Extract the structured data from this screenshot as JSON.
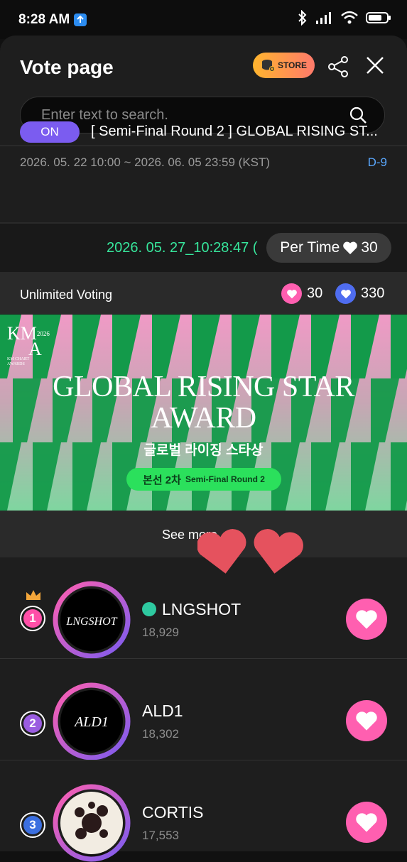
{
  "status_bar": {
    "time": "8:28 AM"
  },
  "header": {
    "title": "Vote page",
    "store_label": "STORE"
  },
  "search": {
    "placeholder": "Enter text to search."
  },
  "event": {
    "status": "ON",
    "round_title": "[ Semi-Final Round 2 ] GLOBAL RISING ST...",
    "period": "2026. 05. 22 10:00 ~ 2026. 06. 05 23:59 (KST)",
    "dday": "D-9",
    "timestamp": "2026. 05. 27_10:28:47 (",
    "per_time_label": "Per Time",
    "per_time_value": "30"
  },
  "voting": {
    "label": "Unlimited Voting",
    "pink_hearts": "30",
    "blue_hearts": "330"
  },
  "banner": {
    "logo_top": "KM",
    "logo_bottom": "A",
    "logo_year": "2026",
    "logo_sub": "KM CHART AWARDS",
    "title_line1": "GLOBAL RISING STAR",
    "title_line2": "AWARD",
    "korean_title": "글로벌 라이징 스타상",
    "pill_korean": "본선 2차",
    "pill_english": "Semi-Final Round 2"
  },
  "see_more": "See more",
  "artists": [
    {
      "rank": "1",
      "name": "LNGSHOT",
      "votes": "18,929",
      "logo_text": "LNGSHOT",
      "rank_color": "#ff4fa8"
    },
    {
      "rank": "2",
      "name": "ALD1",
      "votes": "18,302",
      "logo_text": "ALD1",
      "rank_color": "#9a5ce0"
    },
    {
      "rank": "3",
      "name": "CORTIS",
      "votes": "17,553",
      "logo_text": "",
      "rank_color": "#3b6fe0"
    }
  ],
  "colors": {
    "accent_pink": "#ff5fb0",
    "on_badge": "#7b5cf0",
    "timer_green": "#37e69c",
    "dday_blue": "#5aa8ff"
  }
}
